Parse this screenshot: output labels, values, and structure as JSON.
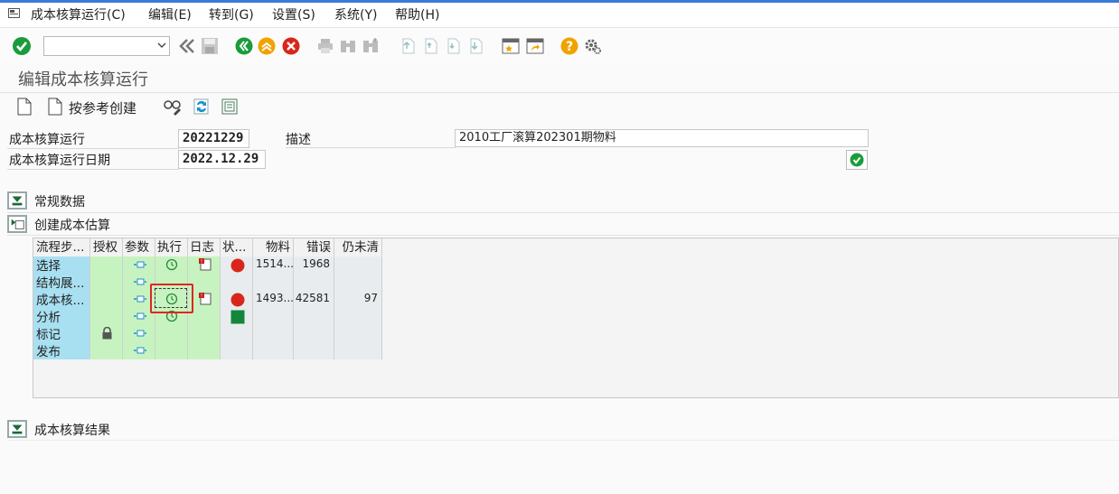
{
  "menu": {
    "items": [
      "成本核算运行(C)",
      "编辑(E)",
      "转到(G)",
      "设置(S)",
      "系统(Y)",
      "帮助(H)"
    ]
  },
  "toolbar": {
    "command_value": ""
  },
  "page_title": "编辑成本核算运行",
  "app_toolbar": {
    "create_by_reference": "按参考创建"
  },
  "header_fields": {
    "run_label": "成本核算运行",
    "run_value": "20221229",
    "desc_label": "描述",
    "desc_value": "2010工厂滚算202301期物料",
    "date_label": "成本核算运行日期",
    "date_value": "2022.12.29"
  },
  "sections": {
    "general": "常规数据",
    "create_estimate": "创建成本估算",
    "results": "成本核算结果"
  },
  "grid": {
    "headers": [
      "流程步...",
      "授权",
      "参数",
      "执行",
      "日志",
      "状...",
      "物料",
      "错误",
      "仍未清"
    ],
    "steps": [
      "选择",
      "结构展...",
      "成本核...",
      "分析",
      "标记",
      "发布"
    ],
    "rows": [
      {
        "material": "1514...",
        "errors": "1968",
        "open": ""
      },
      {
        "material": "",
        "errors": "",
        "open": ""
      },
      {
        "material": "1493...",
        "errors": "42581",
        "open": "97"
      },
      {
        "material": "",
        "errors": "",
        "open": ""
      },
      {
        "material": "",
        "errors": "",
        "open": ""
      },
      {
        "material": "",
        "errors": "",
        "open": ""
      }
    ]
  },
  "colors": {
    "accent": "#3a7bd5",
    "ok_green": "#1a9c3c",
    "status_red": "#d9261c",
    "status_green": "#13863b",
    "highlight": "#e2251f"
  }
}
